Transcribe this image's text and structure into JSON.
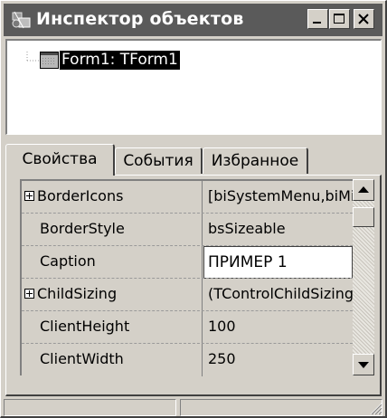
{
  "window": {
    "title": "Инспектор объектов",
    "controls": {
      "minimize": "minimize-icon",
      "maximize": "maximize-icon",
      "close": "close-icon"
    }
  },
  "tree": {
    "items": [
      {
        "label": "Form1: TForm1",
        "icon": "form-icon",
        "selected": true
      }
    ]
  },
  "tabs": [
    {
      "label": "Свойства",
      "active": true
    },
    {
      "label": "События",
      "active": false
    },
    {
      "label": "Избранное",
      "active": false
    }
  ],
  "properties": [
    {
      "name": "BorderIcons",
      "value": "[biSystemMenu,biMinimize,biMaximize]",
      "expandable": true
    },
    {
      "name": "BorderStyle",
      "value": "bsSizeable",
      "expandable": false
    },
    {
      "name": "Caption",
      "value": "ПРИМЕР 1",
      "expandable": false,
      "editing": true
    },
    {
      "name": "ChildSizing",
      "value": "(TControlChildSizing)",
      "expandable": true
    },
    {
      "name": "ClientHeight",
      "value": "100",
      "expandable": false
    },
    {
      "name": "ClientWidth",
      "value": "250",
      "expandable": false
    }
  ],
  "status": {
    "left": "",
    "right": ""
  },
  "colors": {
    "titlebar": "#5a5a5a",
    "face": "#d4d0c8",
    "selection": "#000000"
  }
}
